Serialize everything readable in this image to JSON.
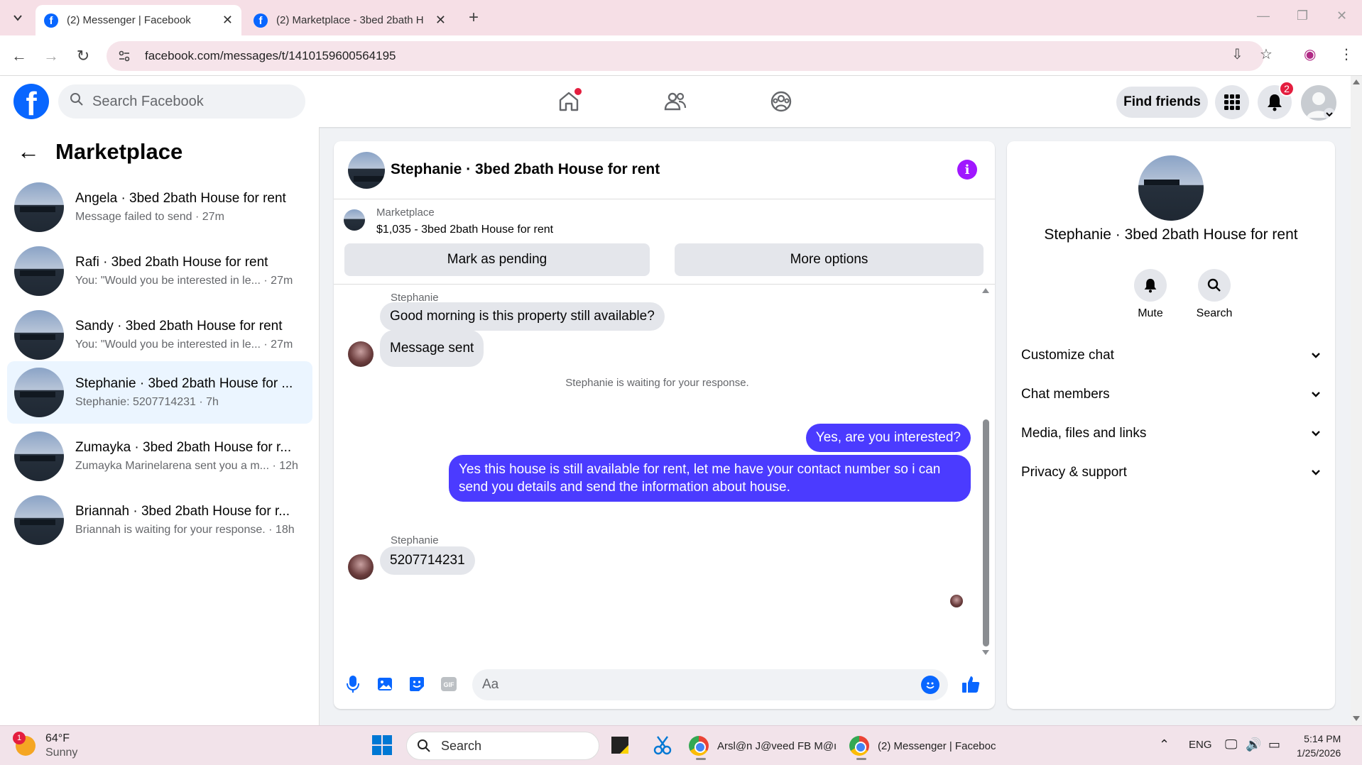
{
  "browser": {
    "tabs": [
      {
        "title": "(2) Messenger | Facebook",
        "active": true
      },
      {
        "title": "(2) Marketplace - 3bed 2bath H",
        "active": false
      }
    ],
    "url": "facebook.com/messages/t/1410159600564195"
  },
  "fb_header": {
    "search_placeholder": "Search Facebook",
    "find_friends": "Find friends",
    "notification_count": "2"
  },
  "left_panel": {
    "title": "Marketplace",
    "conversations": [
      {
        "name": "Angela · 3bed 2bath House for rent",
        "preview": "Message failed to send · 27m"
      },
      {
        "name": "Rafi · 3bed 2bath House for rent",
        "preview": "You: \"Would you be interested in le... · 27m"
      },
      {
        "name": "Sandy · 3bed 2bath House for rent",
        "preview": "You: \"Would you be interested in le... · 27m"
      },
      {
        "name": "Stephanie · 3bed 2bath House for ...",
        "preview": "Stephanie: 5207714231 · 7h"
      },
      {
        "name": "Zumayka · 3bed 2bath House for r...",
        "preview": "Zumayka Marinelarena sent you a m... · 12h"
      },
      {
        "name": "Briannah · 3bed 2bath House for r...",
        "preview": "Briannah is waiting for your response. · 18h"
      }
    ]
  },
  "chat": {
    "title": "Stephanie · 3bed 2bath House for rent",
    "marketplace_label": "Marketplace",
    "listing": "$1,035 - 3bed 2bath House for rent",
    "mark_pending": "Mark as pending",
    "more_options": "More options",
    "sender1": "Stephanie",
    "msg1": "Good morning is this property still available?",
    "msg2": "Message sent",
    "waiting_note": "Stephanie is waiting for your response.",
    "out1": "Yes, are you interested?",
    "out2": "Yes this house is still available for rent, let me have your contact number so i can send you details and send the information about house.",
    "sender2": "Stephanie",
    "msg3": "5207714231",
    "composer_placeholder": "Aa"
  },
  "right_panel": {
    "name": "Stephanie · 3bed 2bath House for rent",
    "mute": "Mute",
    "search": "Search",
    "sections": [
      "Customize chat",
      "Chat members",
      "Media, files and links",
      "Privacy & support"
    ]
  },
  "taskbar": {
    "weather_temp": "64°F",
    "weather_desc": "Sunny",
    "weather_badge": "1",
    "search": "Search",
    "app1": "Arsl@n J@veed FB M@ı",
    "app2": "(2) Messenger | Faceboc",
    "lang": "ENG",
    "time": "5:14 PM",
    "date": "1/25/2026"
  },
  "colors": {
    "fb_blue": "#0866ff",
    "outgoing_bubble": "#4b3bff",
    "info_purple": "#a017ff",
    "selected_row": "#ebf5ff"
  }
}
